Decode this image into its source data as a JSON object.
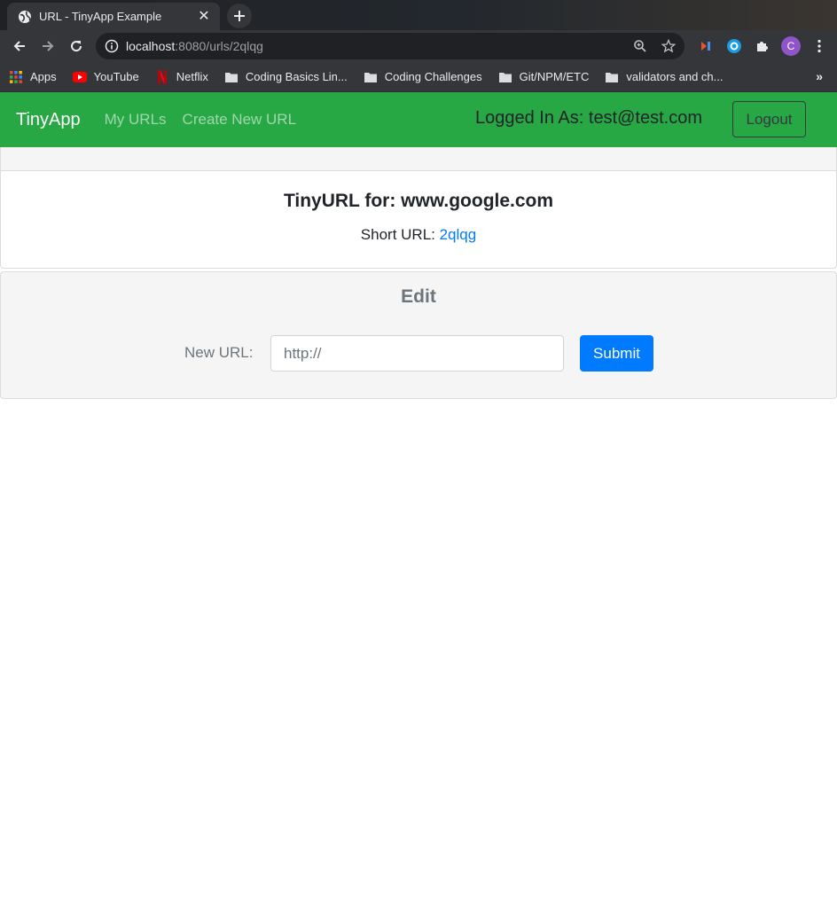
{
  "browser": {
    "tab_title": "URL - TinyApp Example",
    "tab_close": "✕",
    "new_tab": "+",
    "url_host": "localhost",
    "url_path": ":8080/urls/2qlqg",
    "profile_initial": "C",
    "bookmarks": [
      {
        "label": "Apps",
        "icon": "apps-grid-icon"
      },
      {
        "label": "YouTube",
        "icon": "youtube-icon"
      },
      {
        "label": "Netflix",
        "icon": "netflix-icon"
      },
      {
        "label": "Coding Basics Lin...",
        "icon": "folder-icon"
      },
      {
        "label": "Coding Challenges",
        "icon": "folder-icon"
      },
      {
        "label": "Git/NPM/ETC",
        "icon": "folder-icon"
      },
      {
        "label": "validators and ch...",
        "icon": "folder-icon"
      }
    ],
    "bookmarks_more": "»"
  },
  "navbar": {
    "brand": "TinyApp",
    "links": [
      "My URLs",
      "Create New URL"
    ],
    "logged_in": "Logged In As: test@test.com",
    "logout_label": "Logout",
    "color": "#28a745"
  },
  "url_card": {
    "title": "TinyURL for: www.google.com",
    "short_url_label": "Short URL: ",
    "short_url_value": "2qlqg"
  },
  "edit": {
    "title": "Edit",
    "label": "New URL:",
    "placeholder": "http://",
    "submit_label": "Submit",
    "submit_color": "#007bff"
  }
}
